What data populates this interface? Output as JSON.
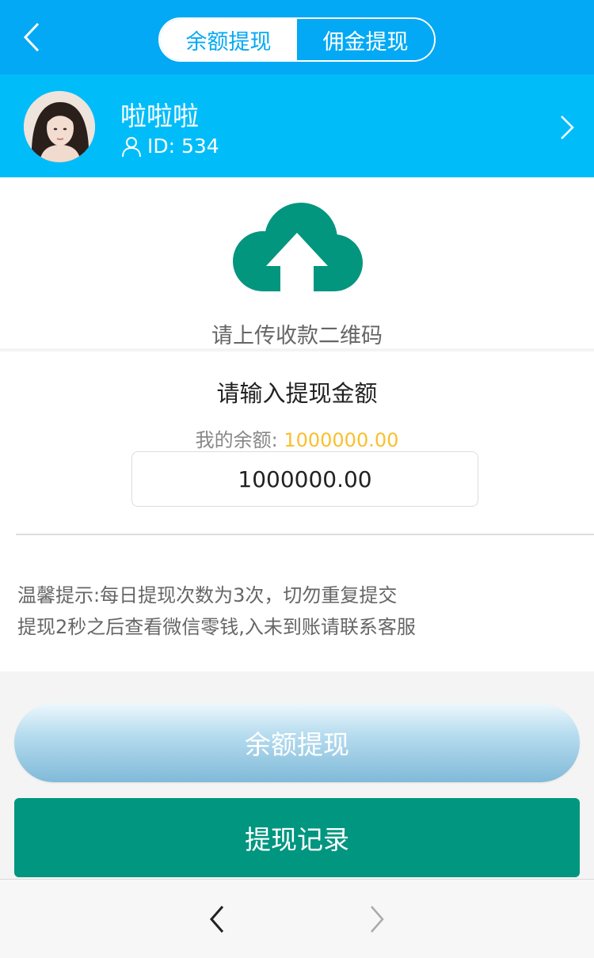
{
  "header": {
    "tabs": [
      {
        "label": "余额提现",
        "active": true
      },
      {
        "label": "佣金提现",
        "active": false
      }
    ],
    "back_icon": "chevron-left-icon"
  },
  "profile": {
    "name": "啦啦啦",
    "id_text": "ID: 534"
  },
  "upload": {
    "icon": "cloud-upload-icon",
    "label": "请上传收款二维码"
  },
  "amount": {
    "title": "请输入提现金额",
    "balance_label": "我的余额: ",
    "balance_value": "1000000.00",
    "input_value": "1000000.00"
  },
  "tips": {
    "line1": "温馨提示:每日提现次数为3次，切勿重复提交",
    "line2": "提现2秒之后查看微信零钱,入未到账请联系客服"
  },
  "buttons": {
    "withdraw": "余额提现",
    "records": "提现记录"
  },
  "colors": {
    "header_blue": "#03a9f4",
    "profile_blue": "#00bdfa",
    "teal": "#00967f",
    "balance_yellow": "#f9c02d"
  }
}
